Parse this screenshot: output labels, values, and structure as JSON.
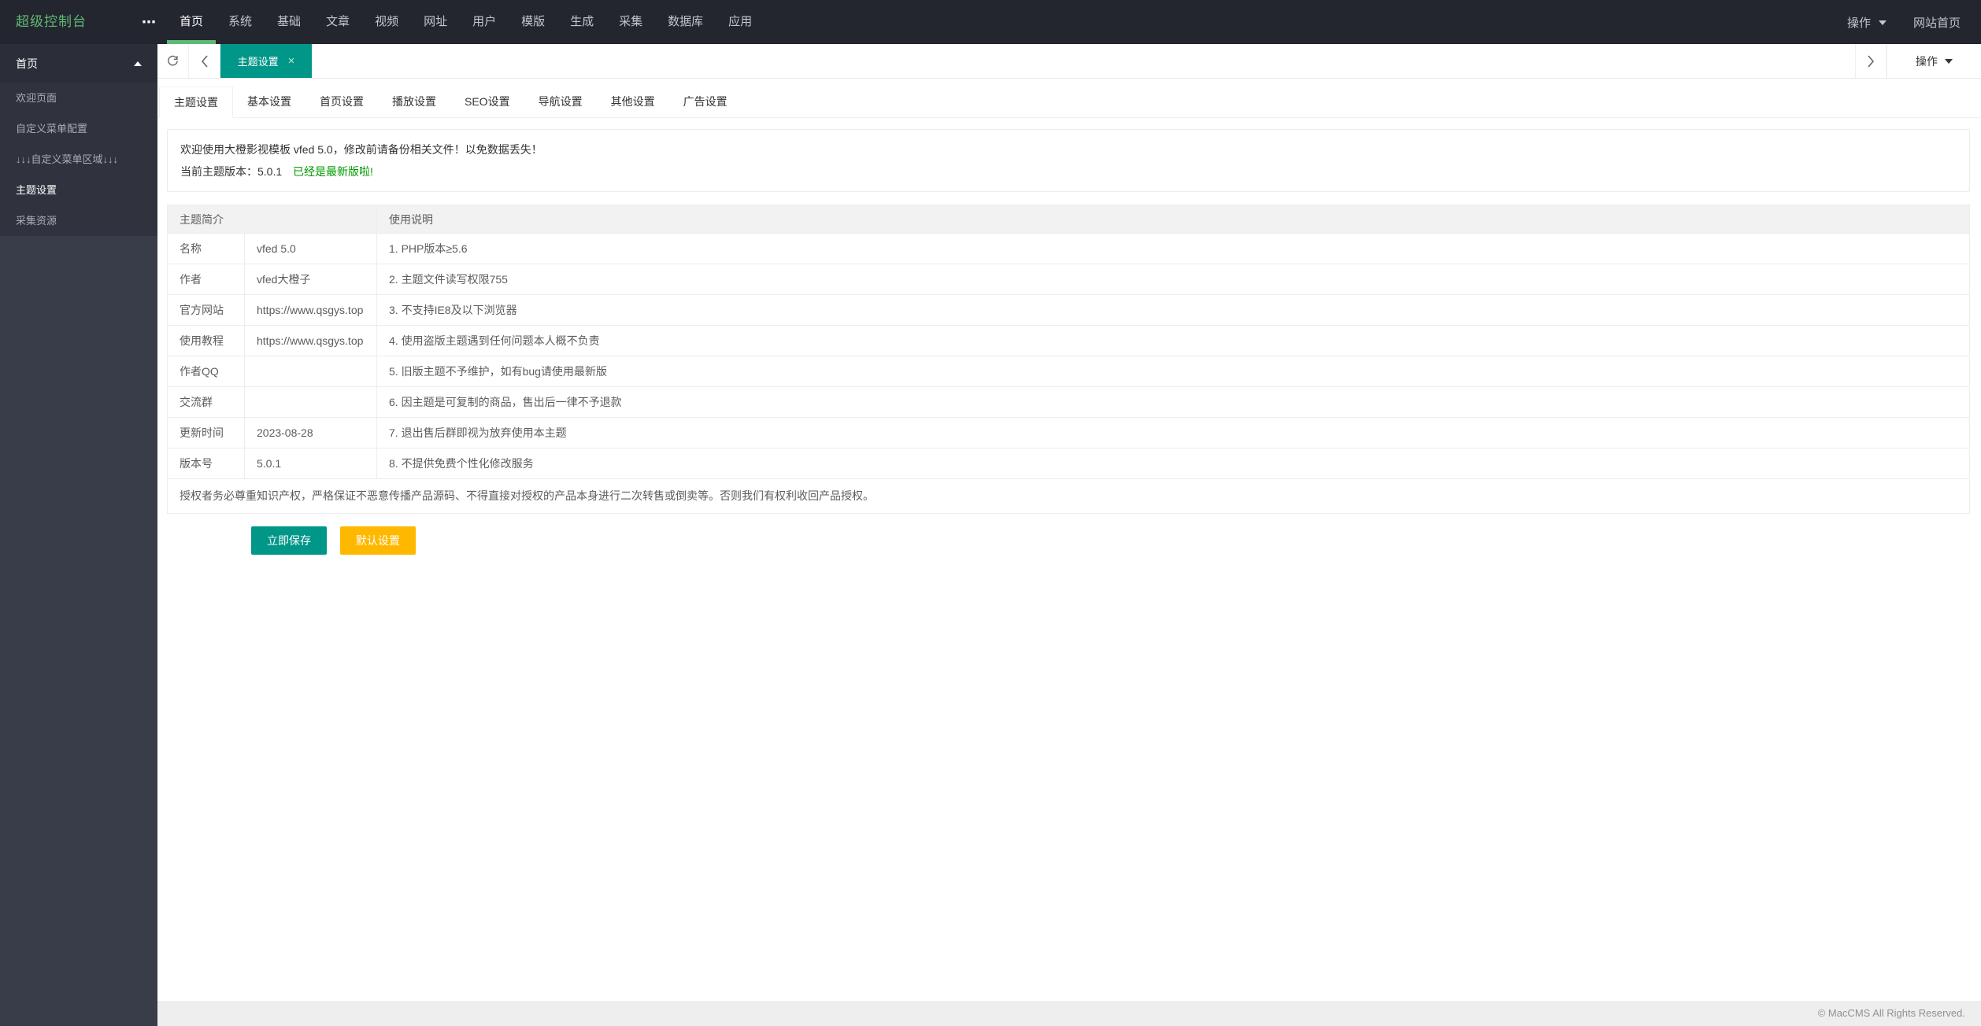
{
  "header": {
    "logo": "超级控制台",
    "nav_items": [
      {
        "label": "首页",
        "active": true
      },
      "系统",
      "基础",
      "文章",
      "视频",
      "网址",
      "用户",
      "模版",
      "生成",
      "采集",
      "数据库",
      "应用"
    ],
    "action_label": "操作",
    "site_home_label": "网站首页"
  },
  "sidebar": {
    "group_label": "首页",
    "items": [
      "欢迎页面",
      "自定义菜单配置",
      "↓↓↓自定义菜单区域↓↓↓",
      {
        "label": "主题设置",
        "active": true
      },
      "采集资源"
    ]
  },
  "tabstrip": {
    "active_tab_label": "主题设置",
    "close_icon": "×",
    "action_label": "操作"
  },
  "settings_tabs": [
    {
      "label": "主题设置",
      "active": true
    },
    "基本设置",
    "首页设置",
    "播放设置",
    "SEO设置",
    "导航设置",
    "其他设置",
    "广告设置"
  ],
  "alert": {
    "line1": "欢迎使用大橙影视模板 vfed 5.0，修改前请备份相关文件！以免数据丢失！",
    "line2": "当前主题版本：5.0.1",
    "line2_highlight": "已经是最新版啦!"
  },
  "intro_table": {
    "col_intro": "主题简介",
    "col_usage": "使用说明",
    "rows": [
      {
        "label": "名称",
        "value": "vfed 5.0",
        "note": "1. PHP版本≥5.6"
      },
      {
        "label": "作者",
        "value": "vfed大橙子",
        "note": "2. 主题文件读写权限755"
      },
      {
        "label": "官方网站",
        "value": "https://www.qsgys.top",
        "note": "3. 不支持IE8及以下浏览器"
      },
      {
        "label": "使用教程",
        "value": "https://www.qsgys.top",
        "note": "4. 使用盗版主题遇到任何问题本人概不负责"
      },
      {
        "label": "作者QQ",
        "value": "",
        "note": "5. 旧版主题不予维护，如有bug请使用最新版"
      },
      {
        "label": "交流群",
        "value": "",
        "note": "6. 因主题是可复制的商品，售出后一律不予退款"
      },
      {
        "label": "更新时间",
        "value": "2023-08-28",
        "note": "7. 退出售后群即视为放弃使用本主题"
      },
      {
        "label": "版本号",
        "value": "5.0.1",
        "note": "8. 不提供免费个性化修改服务"
      }
    ],
    "footer_note": "授权者务必尊重知识产权，严格保证不恶意传播产品源码、不得直接对授权的产品本身进行二次转售或倒卖等。否则我们有权利收回产品授权。"
  },
  "actions": {
    "save_label": "立即保存",
    "default_label": "默认设置"
  },
  "page_footer": {
    "copyright": "© MacCMS All Rights Reserved."
  },
  "colors": {
    "brand_green": "#5FB878",
    "accent_teal": "#009688",
    "warn_yellow": "#FFB800",
    "success_text": "#009900",
    "header_bg": "#23262E",
    "sidebar_bg": "#393D49"
  }
}
